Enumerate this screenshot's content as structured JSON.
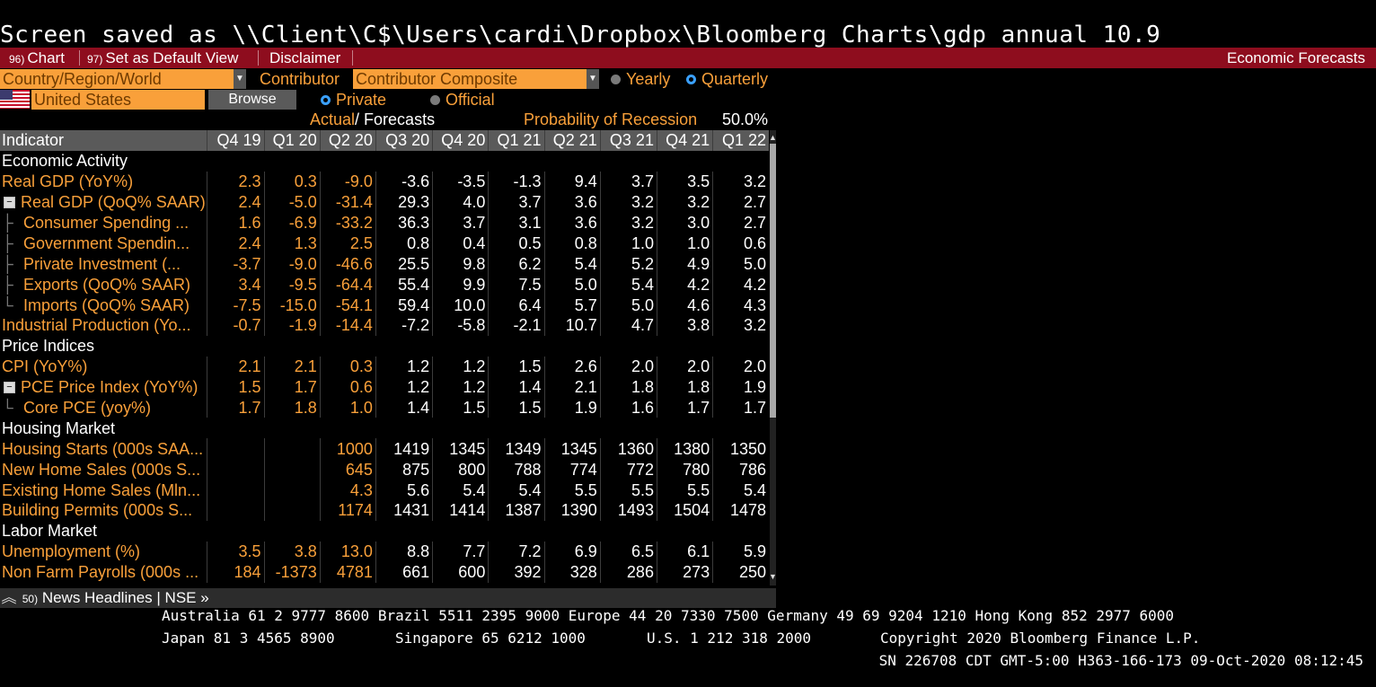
{
  "saved_banner": "Screen saved as \\\\Client\\C$\\Users\\cardi\\Dropbox\\Bloomberg Charts\\gdp annual 10.9",
  "menubar": {
    "chart_num": "96)",
    "chart_label": "Chart",
    "default_num": "97)",
    "default_label": "Set as Default View",
    "disclaimer": "Disclaimer",
    "title": "Economic Forecasts",
    "bg_color": "#8e0d1e"
  },
  "controls": {
    "region_label": "Country/Region/World",
    "contributor_label": "Contributor",
    "contributor_value": "Contributor Composite",
    "yearly": "Yearly",
    "quarterly": "Quarterly",
    "period_selected": "Quarterly",
    "country": "United States",
    "browse": "Browse",
    "private": "Private",
    "official": "Official",
    "source_selected": "Private",
    "actual_label": "Actual",
    "forecast_label": "Forecasts",
    "recession_label": "Probability of Recession",
    "recession_value": "50.0%",
    "accent_color": "#f9a03a"
  },
  "table": {
    "header": [
      "Indicator",
      "Q4 19",
      "Q1 20",
      "Q2 20",
      "Q3 20",
      "Q4 20",
      "Q1 21",
      "Q2 21",
      "Q3 21",
      "Q4 21",
      "Q1 22"
    ],
    "actual_columns": 3,
    "rows": [
      {
        "type": "section",
        "label": "Economic Activity"
      },
      {
        "type": "row",
        "label": "Real GDP (YoY%)",
        "values": [
          "2.3",
          "0.3",
          "-9.0",
          "-3.6",
          "-3.5",
          "-1.3",
          "9.4",
          "3.7",
          "3.5",
          "3.2"
        ]
      },
      {
        "type": "row",
        "expand": "minus",
        "label": "Real GDP (QoQ% SAAR)",
        "values": [
          "2.4",
          "-5.0",
          "-31.4",
          "29.3",
          "4.0",
          "3.7",
          "3.6",
          "3.2",
          "3.2",
          "2.7"
        ]
      },
      {
        "type": "row",
        "tree": "mid",
        "label": "Consumer Spending ...",
        "values": [
          "1.6",
          "-6.9",
          "-33.2",
          "36.3",
          "3.7",
          "3.1",
          "3.6",
          "3.2",
          "3.0",
          "2.7"
        ]
      },
      {
        "type": "row",
        "tree": "mid",
        "label": "Government Spendin...",
        "values": [
          "2.4",
          "1.3",
          "2.5",
          "0.8",
          "0.4",
          "0.5",
          "0.8",
          "1.0",
          "1.0",
          "0.6"
        ]
      },
      {
        "type": "row",
        "tree": "mid",
        "label": "Private Investment (...",
        "values": [
          "-3.7",
          "-9.0",
          "-46.6",
          "25.5",
          "9.8",
          "6.2",
          "5.4",
          "5.2",
          "4.9",
          "5.0"
        ]
      },
      {
        "type": "row",
        "tree": "mid",
        "label": "Exports (QoQ% SAAR)",
        "values": [
          "3.4",
          "-9.5",
          "-64.4",
          "55.4",
          "9.9",
          "7.5",
          "5.0",
          "5.4",
          "4.2",
          "4.2"
        ]
      },
      {
        "type": "row",
        "tree": "end",
        "label": "Imports (QoQ% SAAR)",
        "values": [
          "-7.5",
          "-15.0",
          "-54.1",
          "59.4",
          "10.0",
          "6.4",
          "5.7",
          "5.0",
          "4.6",
          "4.3"
        ]
      },
      {
        "type": "row",
        "label": "Industrial Production (Yo...",
        "values": [
          "-0.7",
          "-1.9",
          "-14.4",
          "-7.2",
          "-5.8",
          "-2.1",
          "10.7",
          "4.7",
          "3.8",
          "3.2"
        ]
      },
      {
        "type": "section",
        "label": "Price Indices"
      },
      {
        "type": "row",
        "label": "CPI (YoY%)",
        "values": [
          "2.1",
          "2.1",
          "0.3",
          "1.2",
          "1.2",
          "1.5",
          "2.6",
          "2.0",
          "2.0",
          "2.0"
        ]
      },
      {
        "type": "row",
        "expand": "minus",
        "label": "PCE Price Index (YoY%)",
        "values": [
          "1.5",
          "1.7",
          "0.6",
          "1.2",
          "1.2",
          "1.4",
          "2.1",
          "1.8",
          "1.8",
          "1.9"
        ]
      },
      {
        "type": "row",
        "tree": "end",
        "label": "Core PCE (yoy%)",
        "values": [
          "1.7",
          "1.8",
          "1.0",
          "1.4",
          "1.5",
          "1.5",
          "1.9",
          "1.6",
          "1.7",
          "1.7"
        ]
      },
      {
        "type": "section",
        "label": "Housing Market"
      },
      {
        "type": "row",
        "label": "Housing Starts (000s SAA...",
        "values": [
          "",
          "",
          "1000",
          "1419",
          "1345",
          "1349",
          "1345",
          "1360",
          "1380",
          "1350"
        ]
      },
      {
        "type": "row",
        "label": "New Home Sales (000s S...",
        "values": [
          "",
          "",
          "645",
          "875",
          "800",
          "788",
          "774",
          "772",
          "780",
          "786"
        ]
      },
      {
        "type": "row",
        "label": "Existing Home Sales (Mln...",
        "values": [
          "",
          "",
          "4.3",
          "5.6",
          "5.4",
          "5.4",
          "5.5",
          "5.5",
          "5.5",
          "5.4"
        ]
      },
      {
        "type": "row",
        "label": "Building Permits (000s S...",
        "values": [
          "",
          "",
          "1174",
          "1431",
          "1414",
          "1387",
          "1390",
          "1493",
          "1504",
          "1478"
        ]
      },
      {
        "type": "section",
        "label": "Labor Market"
      },
      {
        "type": "row",
        "label": "Unemployment (%)",
        "values": [
          "3.5",
          "3.8",
          "13.0",
          "8.8",
          "7.7",
          "7.2",
          "6.9",
          "6.5",
          "6.1",
          "5.9"
        ]
      },
      {
        "type": "row",
        "label": "Non Farm Payrolls (000s ...",
        "values": [
          "184",
          "-1373",
          "4781",
          "661",
          "600",
          "392",
          "328",
          "286",
          "273",
          "250"
        ]
      }
    ]
  },
  "bottombar": {
    "num": "50)",
    "news": "News Headlines",
    "sep": "|",
    "nse": "NSE »"
  },
  "footer": {
    "line1": "Australia 61 2 9777 8600 Brazil 5511 2395 9000 Europe 44 20 7330 7500 Germany 49 69 9204 1210 Hong Kong 852 2977 6000",
    "line2_japan": "Japan 81 3 4565 8900",
    "line2_singapore": "Singapore 65 6212 1000",
    "line2_us": "U.S. 1 212 318 2000",
    "line2_copyright": "Copyright 2020 Bloomberg Finance L.P.",
    "line3": "SN 226708 CDT  GMT-5:00 H363-166-173 09-Oct-2020 08:12:45"
  }
}
